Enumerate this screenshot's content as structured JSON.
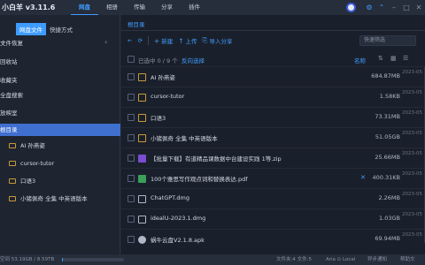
{
  "app": {
    "title": "小白羊 v3.11.6"
  },
  "nav": {
    "tabs": [
      "网盘",
      "相册",
      "传输",
      "分享",
      "插件"
    ]
  },
  "sidebar": {
    "tabs": [
      "网盘文件",
      "快捷方式"
    ],
    "items": [
      "文件恢复",
      "回收站",
      "收藏夹",
      "全盘搜索",
      "放映室",
      "根目录"
    ],
    "tree": [
      "AI 孙燕姿",
      "cursor-tutor",
      "口语3",
      "小猪佩奇 全集 中英语版本"
    ]
  },
  "main": {
    "breadcrumb": "根目录",
    "toolbar": {
      "new": "新建",
      "upload": "上传",
      "import": "导入分享"
    },
    "filter_placeholder": "快速筛选",
    "header": {
      "selected": "已选中 0 / 9 个",
      "invert": "反向选择",
      "sort": "名称"
    },
    "files": [
      {
        "name": "AI 孙燕姿",
        "size": "684.87MB",
        "date": "2023-05",
        "type": "folder"
      },
      {
        "name": "cursor-tutor",
        "size": "1.58KB",
        "date": "2023-05",
        "type": "folder"
      },
      {
        "name": "口语3",
        "size": "73.31MB",
        "date": "2023-05",
        "type": "folder"
      },
      {
        "name": "小猪佩奇 全集 中英语版本",
        "size": "51.05GB",
        "date": "2023-05",
        "type": "folder"
      },
      {
        "name": "【批量下载】有道精品课数据中台建设实践 1等.zip",
        "size": "25.66MB",
        "date": "2023-05",
        "type": "zip"
      },
      {
        "name": "100个雅思写作观点词和替换表达.pdf",
        "size": "400.31KB",
        "date": "2023-05",
        "type": "pdf"
      },
      {
        "name": "ChatGPT.dmg",
        "size": "2.26MB",
        "date": "2023-05",
        "type": "dmg"
      },
      {
        "name": "idealU-2023.1.dmg",
        "size": "1.03GB",
        "date": "2023-05",
        "type": "dmg"
      },
      {
        "name": "蜗牛云盘V2.1.8.apk",
        "size": "69.94MB",
        "date": "2023-05",
        "type": "apk"
      }
    ]
  },
  "status": {
    "space": "空间 53.19GB / 8.59TB",
    "space_used_fraction": 0.006,
    "counts": "文件夹:4  文件:5",
    "aria": "Aria ⊙ Local",
    "sync": "异步通知",
    "help": "帮助文"
  },
  "colors": {
    "accent": "#3f9cff",
    "selected": "#3f6fcf",
    "folder": "#c89a3a"
  }
}
